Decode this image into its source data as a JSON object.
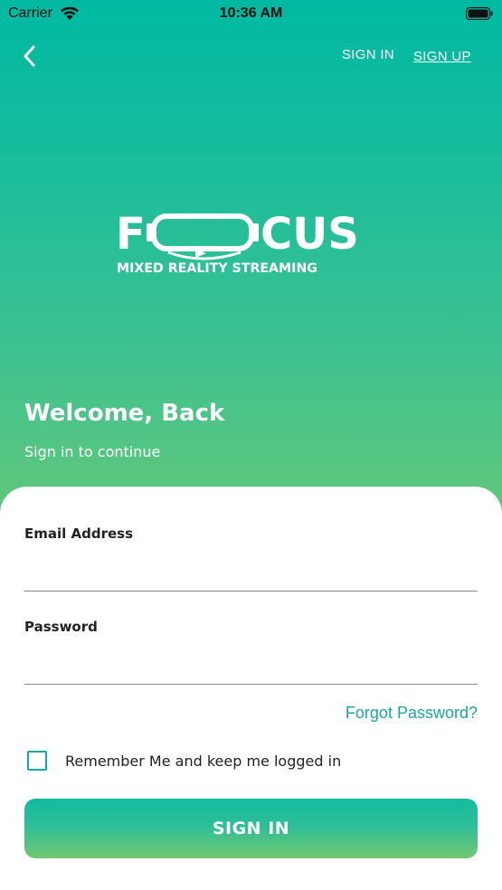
{
  "status_bar": {
    "carrier": "Carrier",
    "time": "10:36 AM"
  },
  "nav": {
    "back_icon": "chevron-left-icon",
    "sign_in": "SIGN IN",
    "sign_up": "SIGN UP"
  },
  "logo": {
    "word_start": "F",
    "word_end": "CUS",
    "tagline": "MIXED REALITY STREAMING"
  },
  "hero": {
    "title": "Welcome, Back",
    "subtitle": "Sign in to continue"
  },
  "form": {
    "email_label": "Email Address",
    "email_value": "",
    "password_label": "Password",
    "password_value": "",
    "forgot_password": "Forgot Password?",
    "remember_label": "Remember Me and keep me logged in",
    "remember_checked": false,
    "submit_label": "SIGN IN"
  },
  "colors": {
    "accent": "#17a99a",
    "gradient_top": "#00b9a3",
    "gradient_bottom": "#6fc874"
  }
}
